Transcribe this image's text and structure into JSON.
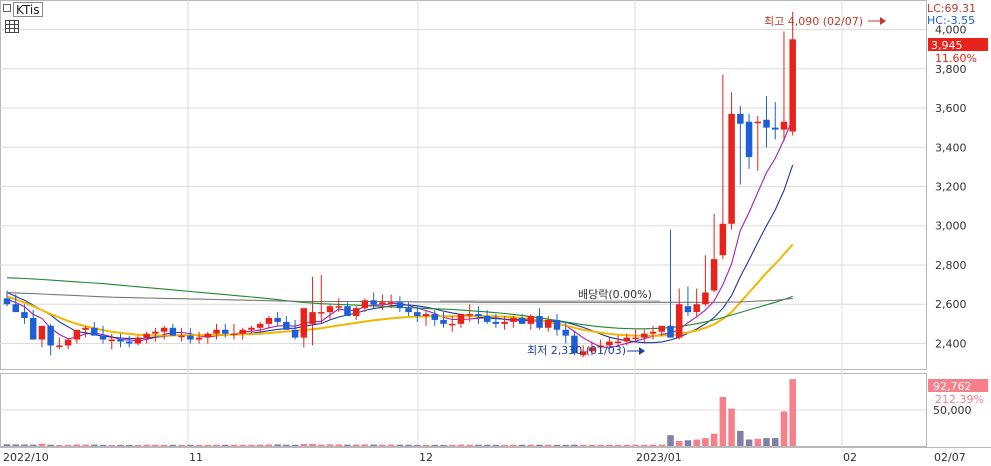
{
  "title": "KTis",
  "indicators": {
    "lc": "LC:69.31",
    "hc": "HC:-3.55"
  },
  "last_price_tag": "3,945",
  "change_pct": "11.60%",
  "volume_tag": "92,762",
  "volume_pct": "212.39%",
  "annotations": {
    "high": "최고 4,090 (02/07)",
    "low": "최저 2,330 (01/03)",
    "dividend": "배당락(0.00%)"
  },
  "colors": {
    "up": "#e8231b",
    "down": "#1f5fd6",
    "up_vol": "#f77f8a",
    "down_vol": "#7f7fa8"
  },
  "chart_data": {
    "type": "candlestick",
    "price_axis": {
      "ticks": [
        "2,400",
        "2,600",
        "2,800",
        "3,000",
        "3,200",
        "3,400",
        "3,600",
        "3,800",
        "4,000"
      ],
      "range": [
        2270,
        4130
      ]
    },
    "volume_axis": {
      "ticks": [
        "50,000"
      ],
      "range": [
        0,
        100000
      ]
    },
    "x_labels": [
      "2022/10",
      "11",
      "12",
      "2023/01",
      "02",
      "02/07"
    ],
    "open": [
      2630,
      2600,
      2560,
      2530,
      2420,
      2490,
      2390,
      2390,
      2420,
      2470,
      2480,
      2440,
      2420,
      2420,
      2410,
      2400,
      2430,
      2450,
      2460,
      2480,
      2440,
      2440,
      2420,
      2430,
      2450,
      2470,
      2450,
      2450,
      2470,
      2480,
      2500,
      2530,
      2510,
      2470,
      2430,
      2500,
      2560,
      2560,
      2590,
      2590,
      2540,
      2580,
      2620,
      2600,
      2610,
      2610,
      2580,
      2560,
      2540,
      2550,
      2520,
      2500,
      2500,
      2550,
      2550,
      2540,
      2510,
      2500,
      2510,
      2530,
      2500,
      2540,
      2480,
      2520,
      2470,
      2440,
      2340,
      2360,
      2380,
      2390,
      2410,
      2410,
      2430,
      2430,
      2450,
      2460,
      2490,
      2430,
      2590,
      2560,
      2600,
      2670,
      2850,
      3010,
      3570,
      3530,
      3530,
      3540,
      3500,
      3490,
      3480
    ],
    "high": [
      2670,
      2650,
      2600,
      2570,
      2450,
      2500,
      2430,
      2420,
      2450,
      2490,
      2510,
      2490,
      2450,
      2450,
      2440,
      2440,
      2460,
      2480,
      2490,
      2500,
      2480,
      2480,
      2460,
      2460,
      2500,
      2500,
      2500,
      2480,
      2490,
      2510,
      2540,
      2560,
      2540,
      2520,
      2470,
      2740,
      2750,
      2600,
      2630,
      2610,
      2590,
      2630,
      2660,
      2650,
      2650,
      2640,
      2610,
      2590,
      2570,
      2570,
      2560,
      2540,
      2540,
      2600,
      2590,
      2570,
      2550,
      2540,
      2540,
      2550,
      2550,
      2580,
      2540,
      2550,
      2510,
      2460,
      2390,
      2410,
      2420,
      2430,
      2440,
      2450,
      2470,
      2470,
      2490,
      2490,
      2980,
      2680,
      2690,
      2680,
      2850,
      3060,
      3770,
      3680,
      3610,
      3570,
      3560,
      3660,
      3630,
      3990,
      4090
    ],
    "low": [
      2590,
      2560,
      2500,
      2420,
      2380,
      2340,
      2370,
      2370,
      2400,
      2430,
      2440,
      2400,
      2370,
      2380,
      2380,
      2390,
      2400,
      2410,
      2420,
      2440,
      2410,
      2400,
      2400,
      2400,
      2420,
      2430,
      2420,
      2420,
      2450,
      2460,
      2480,
      2490,
      2470,
      2420,
      2380,
      2390,
      2500,
      2520,
      2560,
      2550,
      2520,
      2560,
      2580,
      2570,
      2580,
      2560,
      2540,
      2510,
      2490,
      2490,
      2480,
      2460,
      2480,
      2510,
      2500,
      2500,
      2480,
      2470,
      2480,
      2500,
      2470,
      2470,
      2460,
      2440,
      2400,
      2340,
      2330,
      2340,
      2360,
      2370,
      2390,
      2390,
      2410,
      2400,
      2420,
      2440,
      2430,
      2420,
      2540,
      2540,
      2590,
      2660,
      2830,
      2980,
      3210,
      3290,
      3280,
      3400,
      3440,
      3430,
      3460
    ],
    "close": [
      2600,
      2560,
      2530,
      2420,
      2490,
      2390,
      2390,
      2420,
      2470,
      2480,
      2440,
      2420,
      2420,
      2410,
      2400,
      2430,
      2450,
      2460,
      2480,
      2440,
      2440,
      2420,
      2430,
      2450,
      2470,
      2450,
      2450,
      2470,
      2480,
      2500,
      2530,
      2510,
      2470,
      2430,
      2580,
      2560,
      2560,
      2590,
      2590,
      2540,
      2580,
      2620,
      2600,
      2610,
      2610,
      2580,
      2560,
      2540,
      2550,
      2520,
      2500,
      2500,
      2550,
      2550,
      2540,
      2510,
      2500,
      2510,
      2530,
      2500,
      2540,
      2480,
      2520,
      2470,
      2440,
      2350,
      2360,
      2380,
      2390,
      2410,
      2410,
      2430,
      2430,
      2450,
      2460,
      2490,
      2430,
      2600,
      2560,
      2600,
      2660,
      2830,
      3010,
      3570,
      3520,
      3350,
      3530,
      3500,
      3490,
      3530,
      3950
    ],
    "volume": [
      2400,
      2200,
      2100,
      1900,
      3000,
      1800,
      1500,
      1600,
      2100,
      2000,
      1900,
      1600,
      1500,
      1500,
      1400,
      1500,
      1900,
      1800,
      1700,
      1700,
      1600,
      1600,
      1500,
      1600,
      1900,
      1700,
      1800,
      1700,
      1700,
      1900,
      2100,
      2200,
      1800,
      1700,
      2800,
      3000,
      2000,
      2300,
      2100,
      1900,
      2100,
      2200,
      2000,
      1900,
      2000,
      1800,
      1700,
      1600,
      1700,
      1600,
      1500,
      1600,
      2000,
      1800,
      1800,
      1700,
      1600,
      1600,
      1700,
      1700,
      1900,
      1700,
      1800,
      1600,
      1500,
      1800,
      1700,
      1600,
      1700,
      1700,
      1600,
      1700,
      1800,
      1700,
      1800,
      1900,
      15000,
      7000,
      8000,
      9000,
      11000,
      17000,
      68000,
      52000,
      21000,
      9000,
      10000,
      11000,
      11000,
      48000,
      92762
    ],
    "ma": [
      {
        "color": "#a020c0",
        "values": [
          2625,
          2609,
          2588,
          2548,
          2528,
          2478,
          2446,
          2424,
          2432,
          2450,
          2452,
          2446,
          2434,
          2420,
          2418,
          2413,
          2421,
          2432,
          2447,
          2456,
          2456,
          2451,
          2438,
          2433,
          2439,
          2443,
          2446,
          2458,
          2462,
          2468,
          2480,
          2489,
          2491,
          2488,
          2502,
          2510,
          2513,
          2545,
          2575,
          2569,
          2568,
          2590,
          2597,
          2596,
          2603,
          2606,
          2593,
          2581,
          2568,
          2553,
          2533,
          2522,
          2522,
          2525,
          2529,
          2531,
          2531,
          2523,
          2517,
          2516,
          2517,
          2512,
          2515,
          2504,
          2491,
          2461,
          2429,
          2404,
          2384,
          2377,
          2389,
          2401,
          2412,
          2425,
          2436,
          2447,
          2453,
          2471,
          2506,
          2536,
          2570,
          2616,
          2700,
          2806,
          2976,
          3068,
          3170,
          3271,
          3343,
          3439,
          3546
        ]
      },
      {
        "color": "#1a3a9c",
        "values": [
          2660,
          2640,
          2620,
          2595,
          2570,
          2545,
          2510,
          2485,
          2460,
          2455,
          2445,
          2438,
          2432,
          2428,
          2425,
          2425,
          2428,
          2432,
          2436,
          2440,
          2442,
          2442,
          2440,
          2440,
          2442,
          2444,
          2446,
          2448,
          2452,
          2458,
          2465,
          2472,
          2476,
          2478,
          2487,
          2495,
          2502,
          2520,
          2535,
          2545,
          2555,
          2568,
          2578,
          2585,
          2592,
          2596,
          2596,
          2592,
          2585,
          2576,
          2565,
          2556,
          2548,
          2540,
          2535,
          2530,
          2527,
          2524,
          2522,
          2521,
          2520,
          2518,
          2516,
          2513,
          2508,
          2496,
          2482,
          2466,
          2448,
          2432,
          2422,
          2414,
          2408,
          2404,
          2404,
          2408,
          2418,
          2432,
          2452,
          2474,
          2500,
          2532,
          2580,
          2644,
          2740,
          2826,
          2915,
          3000,
          3080,
          3180,
          3310
        ]
      },
      {
        "color": "#f0b800",
        "values": [
          2640,
          2625,
          2608,
          2590,
          2570,
          2550,
          2532,
          2515,
          2500,
          2488,
          2478,
          2468,
          2460,
          2454,
          2449,
          2445,
          2442,
          2440,
          2440,
          2441,
          2442,
          2443,
          2443,
          2443,
          2444,
          2445,
          2446,
          2447,
          2448,
          2450,
          2453,
          2457,
          2461,
          2464,
          2468,
          2473,
          2478,
          2485,
          2492,
          2499,
          2505,
          2512,
          2518,
          2523,
          2528,
          2532,
          2535,
          2537,
          2538,
          2539,
          2539,
          2539,
          2539,
          2540,
          2540,
          2540,
          2539,
          2537,
          2534,
          2530,
          2525,
          2518,
          2510,
          2501,
          2491,
          2480,
          2470,
          2462,
          2455,
          2449,
          2445,
          2442,
          2440,
          2439,
          2439,
          2440,
          2443,
          2448,
          2456,
          2466,
          2480,
          2498,
          2526,
          2560,
          2610,
          2660,
          2710,
          2760,
          2805,
          2855,
          2905
        ]
      },
      {
        "color": "#1e8a2e",
        "values": [
          2735,
          2733,
          2731,
          2729,
          2726,
          2723,
          2720,
          2717,
          2714,
          2711,
          2708,
          2705,
          2701,
          2697,
          2693,
          2689,
          2685,
          2681,
          2677,
          2673,
          2669,
          2665,
          2661,
          2657,
          2653,
          2649,
          2645,
          2641,
          2637,
          2633,
          2628,
          2623,
          2618,
          2613,
          2609,
          2606,
          2603,
          2601,
          2599,
          2597,
          2595,
          2593,
          2591,
          2589,
          2587,
          2585,
          2583,
          2581,
          2579,
          2577,
          2575,
          2573,
          2570,
          2567,
          2564,
          2561,
          2557,
          2553,
          2548,
          2543,
          2537,
          2531,
          2524,
          2517,
          2510,
          2503,
          2496,
          2490,
          2485,
          2481,
          2478,
          2476,
          2475,
          2475,
          2476,
          2478,
          2481,
          2486,
          2493,
          2501,
          2510,
          2520,
          2532,
          2545,
          2558,
          2571,
          2584,
          2597,
          2610,
          2624,
          2640
        ]
      },
      {
        "color": "#777777",
        "values": [
          2660,
          2658,
          2656,
          2654,
          2652,
          2650,
          2648,
          2646,
          2644,
          2642,
          2640,
          2638,
          2636,
          2635,
          2634,
          2633,
          2632,
          2631,
          2630,
          2629,
          2628,
          2627,
          2626,
          2625,
          2624,
          2623,
          2622,
          2621,
          2620,
          2619,
          2618,
          2617,
          2616,
          2615,
          2614,
          2614,
          2614,
          2614,
          2614,
          2614,
          2614,
          2614,
          2614,
          2614,
          2613,
          2613,
          2613,
          2612,
          2612,
          2612,
          2611,
          2611,
          2611,
          2611,
          2610,
          2610,
          2610,
          2610,
          2610,
          2610,
          2610,
          2610,
          2610,
          2610,
          2610,
          2610,
          2610,
          2610,
          2610,
          2610,
          2610,
          2610,
          2610,
          2610,
          2610,
          2610,
          2610,
          2610,
          2610,
          2610,
          2610,
          2610,
          2610,
          2611,
          2612,
          2614,
          2616,
          2618,
          2620,
          2625,
          2630
        ]
      }
    ]
  }
}
